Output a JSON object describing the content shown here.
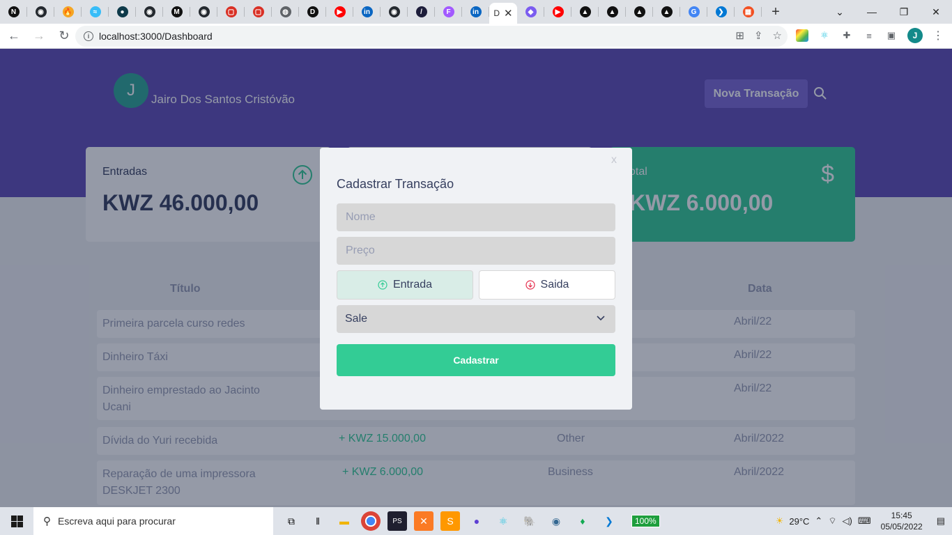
{
  "browser": {
    "tabs": [
      {
        "icon": "notion-icon",
        "color": "#111111",
        "glyph": "N"
      },
      {
        "icon": "github-icon",
        "color": "#24292f",
        "glyph": "◉"
      },
      {
        "icon": "firebase-icon",
        "color": "#f5a623",
        "glyph": "🔥"
      },
      {
        "icon": "tailwind-icon",
        "color": "#38bdf8",
        "glyph": "≈"
      },
      {
        "icon": "circle-app-icon",
        "color": "#0e3a4a",
        "glyph": "●"
      },
      {
        "icon": "github-icon",
        "color": "#24292f",
        "glyph": "◉"
      },
      {
        "icon": "medium-icon",
        "color": "#111111",
        "glyph": "M"
      },
      {
        "icon": "github-icon",
        "color": "#24292f",
        "glyph": "◉"
      },
      {
        "icon": "app-red-icon",
        "color": "#d93025",
        "glyph": "▢"
      },
      {
        "icon": "app-red-icon",
        "color": "#d93025",
        "glyph": "▢"
      },
      {
        "icon": "globe-icon",
        "color": "#5f6368",
        "glyph": "◍"
      },
      {
        "icon": "dev-icon",
        "color": "#111111",
        "glyph": "D"
      },
      {
        "icon": "youtube-icon",
        "color": "#ff0000",
        "glyph": "▶"
      },
      {
        "icon": "linkedin-icon",
        "color": "#0a66c2",
        "glyph": "in"
      },
      {
        "icon": "github-icon",
        "color": "#24292f",
        "glyph": "◉"
      },
      {
        "icon": "app-slash-icon",
        "color": "#1d1d3a",
        "glyph": "/"
      },
      {
        "icon": "figma-icon",
        "color": "#a259ff",
        "glyph": "F"
      },
      {
        "icon": "linkedin-icon",
        "color": "#0a66c2",
        "glyph": "in"
      }
    ],
    "tabs_after": [
      {
        "icon": "shield-icon",
        "color": "#7b5cf0",
        "glyph": "◆"
      },
      {
        "icon": "youtube-icon",
        "color": "#ff0000",
        "glyph": "▶"
      },
      {
        "icon": "triangle-app-icon",
        "color": "#111111",
        "glyph": "▲"
      },
      {
        "icon": "triangle-app-icon",
        "color": "#111111",
        "glyph": "▲"
      },
      {
        "icon": "triangle-app-icon",
        "color": "#111111",
        "glyph": "▲"
      },
      {
        "icon": "triangle-app-icon",
        "color": "#111111",
        "glyph": "▲"
      },
      {
        "icon": "google-icon",
        "color": "#4285f4",
        "glyph": "G"
      },
      {
        "icon": "vscode-icon",
        "color": "#0078d4",
        "glyph": "❯"
      },
      {
        "icon": "microsoft-icon",
        "color": "#f25022",
        "glyph": "▦"
      }
    ],
    "active_tab_label": "D",
    "url": "localhost:3000/Dashboard",
    "profile_initial": "J"
  },
  "header": {
    "avatar_initial": "J",
    "user_name": "Jairo Dos Santos Cristóvão",
    "new_transaction_label": "Nova Transação"
  },
  "summary": {
    "entradas_label": "Entradas",
    "entradas_value": "KWZ 46.000,00",
    "total_label": "otal",
    "total_value": "KWZ 6.000,00"
  },
  "table": {
    "headers": {
      "title": "Título",
      "date": "Data"
    },
    "rows": [
      {
        "title": "Primeira parcela curso redes",
        "amount": "",
        "category": "",
        "date": "Abril/22"
      },
      {
        "title": "Dinheiro Táxi",
        "amount": "",
        "category": "",
        "date": "Abril/22"
      },
      {
        "title": "Dinheiro emprestado ao Jacinto Ucani",
        "amount": "",
        "category": "",
        "date": "Abril/22"
      },
      {
        "title": "Dívida do Yuri recebida",
        "amount": "+ KWZ 15.000,00",
        "category": "Other",
        "date": "Abril/2022"
      },
      {
        "title": "Reparação de uma impressora DESKJET 2300",
        "amount": "+ KWZ 6.000,00",
        "category": "Business",
        "date": "Abril/2022"
      }
    ]
  },
  "modal": {
    "close_label": "x",
    "title": "Cadastrar Transação",
    "name_placeholder": "Nome",
    "price_placeholder": "Preço",
    "income_label": "Entrada",
    "outcome_label": "Saida",
    "category_value": "Sale",
    "submit_label": "Cadastrar"
  },
  "taskbar": {
    "search_placeholder": "Escreva aqui para procurar",
    "battery": "100%",
    "temperature": "29°C",
    "time": "15:45",
    "date": "05/05/2022"
  }
}
